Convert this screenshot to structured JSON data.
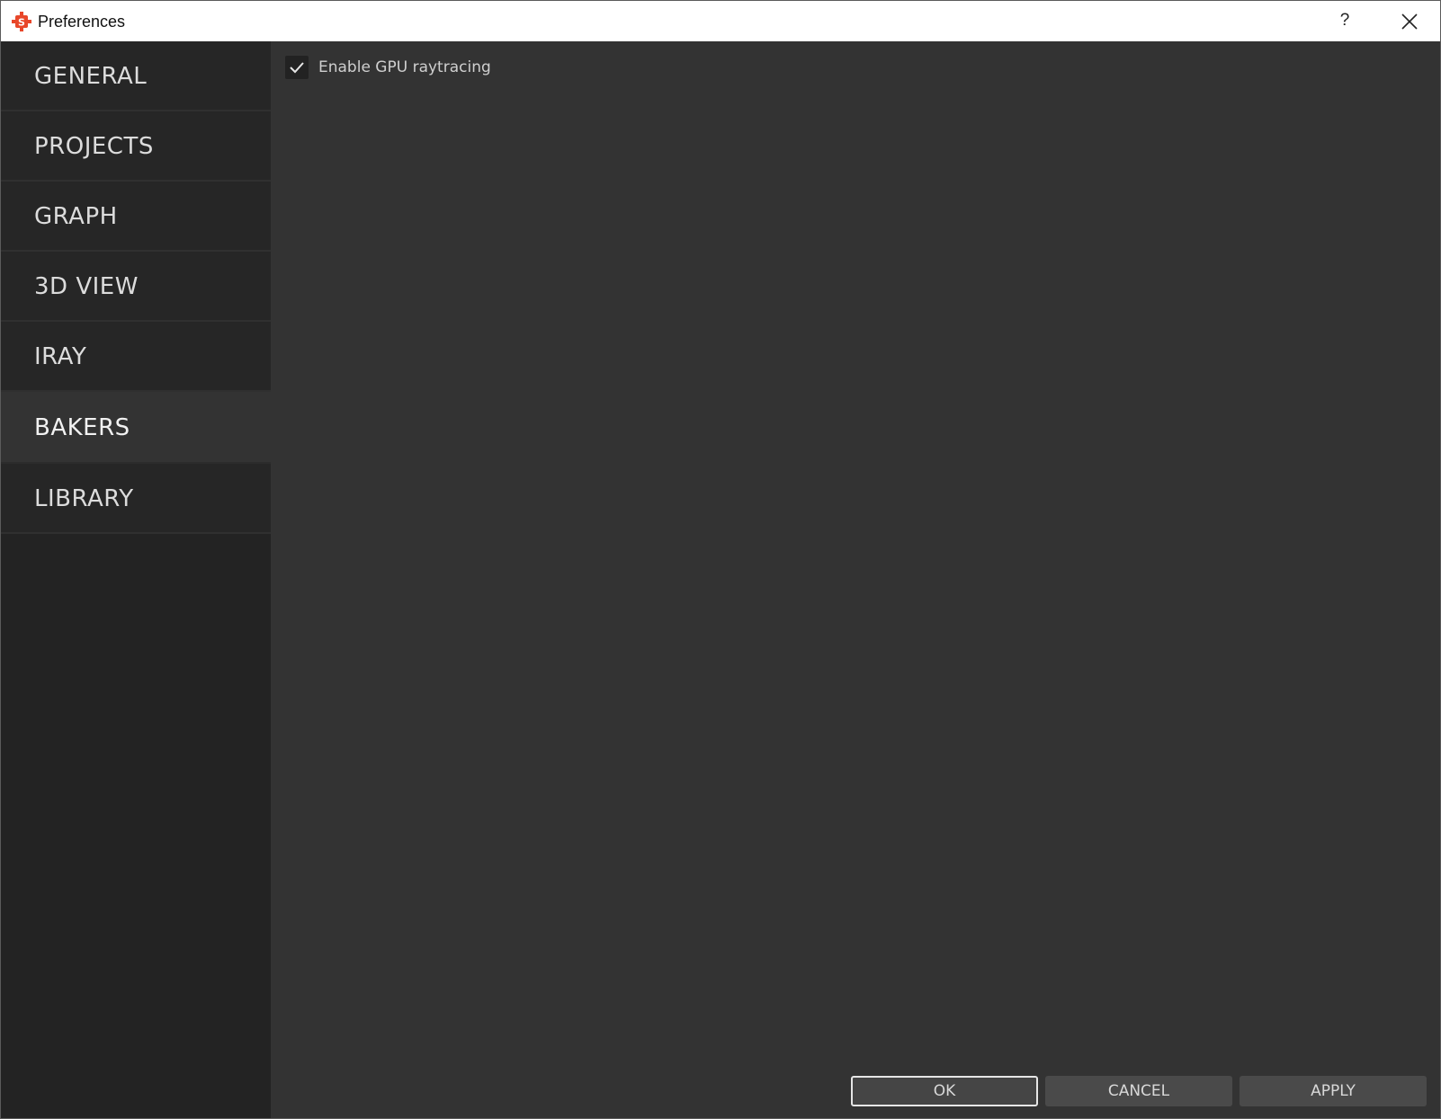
{
  "window": {
    "title": "Preferences",
    "help_label": "?",
    "app_icon": "substance-designer-icon",
    "close_icon": "close-icon"
  },
  "sidebar": {
    "items": [
      {
        "label": "GENERAL",
        "active": false
      },
      {
        "label": "PROJECTS",
        "active": false
      },
      {
        "label": "GRAPH",
        "active": false
      },
      {
        "label": "3D VIEW",
        "active": false
      },
      {
        "label": "IRAY",
        "active": false
      },
      {
        "label": "BAKERS",
        "active": true
      },
      {
        "label": "LIBRARY",
        "active": false
      }
    ]
  },
  "content": {
    "gpu_raytracing": {
      "label": "Enable GPU raytracing",
      "checked": true
    }
  },
  "footer": {
    "ok_label": "OK",
    "cancel_label": "CANCEL",
    "apply_label": "APPLY"
  },
  "colors": {
    "accent": "#e8472a",
    "background": "#333333",
    "sidebar": "#262626"
  }
}
